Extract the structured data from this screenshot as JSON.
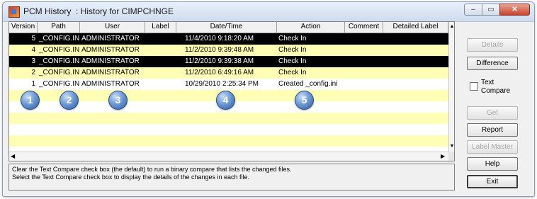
{
  "window": {
    "title": "PCM History  : History for CIMPCHNGE",
    "controls": {
      "minimize": "–",
      "maximize": "▭",
      "close": "✕"
    }
  },
  "grid": {
    "columns": [
      "Version",
      "Path",
      "User",
      "Label",
      "Date/Time",
      "Action",
      "Comment",
      "Detailed Label"
    ],
    "rows": [
      {
        "version": "5",
        "path": "_CONFIG.INI",
        "user": "ADMINISTRATOR",
        "label": "",
        "datetime": "11/4/2010 9:18:20 AM",
        "action": "Check In",
        "comment": "",
        "detailed_label": "",
        "style": "selected"
      },
      {
        "version": "4",
        "path": "_CONFIG.INI",
        "user": "ADMINISTRATOR",
        "label": "",
        "datetime": "11/2/2010 9:39:48 AM",
        "action": "Check In",
        "comment": "",
        "detailed_label": "",
        "style": "yellow"
      },
      {
        "version": "3",
        "path": "_CONFIG.INI",
        "user": "ADMINISTRATOR",
        "label": "",
        "datetime": "11/2/2010 9:39:38 AM",
        "action": "Check In",
        "comment": "",
        "detailed_label": "",
        "style": "selected"
      },
      {
        "version": "2",
        "path": "_CONFIG.INI",
        "user": "ADMINISTRATOR",
        "label": "",
        "datetime": "11/2/2010 6:49:16 AM",
        "action": "Check In",
        "comment": "",
        "detailed_label": "",
        "style": "yellow"
      },
      {
        "version": "1",
        "path": "_CONFIG.INI",
        "user": "ADMINISTRATOR",
        "label": "",
        "datetime": "10/29/2010 2:25:34 PM",
        "action": "Created _config.ini",
        "comment": "",
        "detailed_label": "",
        "style": "white"
      }
    ],
    "callouts": [
      "1",
      "2",
      "3",
      "4",
      "5"
    ]
  },
  "info": {
    "line1": "Clear the Text Compare check box (the default) to run a binary compare that lists the changed files.",
    "line2": "Select the Text Compare check box to display the details of the changes in each file."
  },
  "sidebar": {
    "details": "Details",
    "difference": "Difference",
    "text_compare": "Text Compare",
    "text_compare_checked": false,
    "get": "Get",
    "report": "Report",
    "label_master": "Label Master",
    "help": "Help",
    "exit": "Exit"
  },
  "colors": {
    "row_yellow": "#fffeb4",
    "row_selected": "#000000",
    "callout": "#4a7fc4"
  }
}
